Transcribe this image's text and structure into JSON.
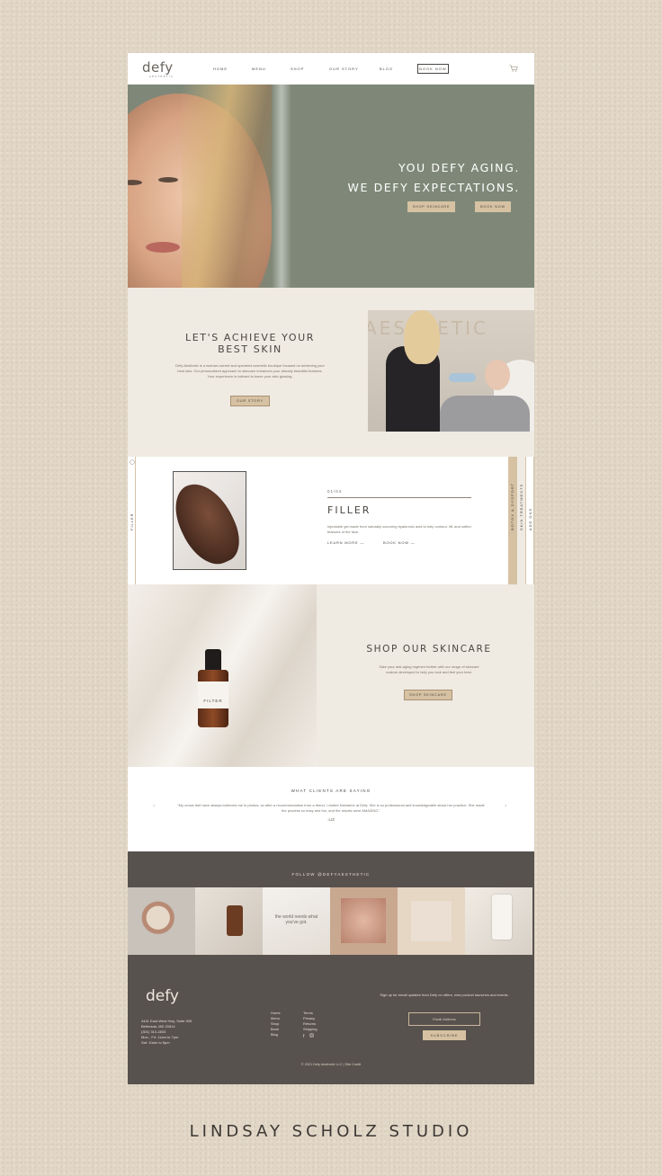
{
  "nav": {
    "logo": "defy",
    "logo_sub": "AESTHETIC",
    "items": [
      "HOME",
      "MENU",
      "SHOP",
      "OUR STORY",
      "BLOG"
    ],
    "book_label": "BOOK NOW",
    "cart_icon": "cart-icon"
  },
  "hero": {
    "line1": "YOU DEFY AGING.",
    "line2": "WE DEFY EXPECTATIONS.",
    "shop_label": "SHOP SKINCARE",
    "book_label": "BOOK NOW"
  },
  "achieve": {
    "title": "LET'S ACHIEVE YOUR BEST SKIN",
    "body": "Defy Aesthetic is a woman-owned and operated cosmetic boutique focused on achieving your best skin. Our personalized approach to skincare enhances your already beautiful features. Your experience is tailored to leave your skin glowing.",
    "button": "OUR STORY",
    "watermark": "AESTHETIC"
  },
  "services": {
    "left_tab": "FILLER",
    "number": "01/04",
    "title": "FILLER",
    "description": "Injectable gel made from naturally occurring hyaluronic acid to help contour, lift, and soften features of the face.",
    "learn_more": "LEARN MORE —",
    "book_now": "BOOK NOW —",
    "right_tabs": [
      "BOTOX & DYSPORT",
      "SKIN TREATMENTS",
      "ADD ONS"
    ]
  },
  "skincare": {
    "title": "SHOP OUR SKINCARE",
    "body": "Take your anti-aging regimen further with our range of skincare custom developed to help you look and feel your best.",
    "button": "SHOP SKINCARE",
    "bottle_label": "FILTER"
  },
  "testimonial": {
    "heading": "WHAT CLIENTS ARE SAYING",
    "quote": "\"My crows feet have always bothered me in photos, so after a recommendation from a friend, I visited Katharine at Defy. She is so professional and knowledgeable about her practice. She made the process so easy and fun, and the results were AMAZING.\"",
    "author": "-LIZ",
    "prev_icon": "chevron-left-icon",
    "next_icon": "chevron-right-icon"
  },
  "instagram": {
    "heading": "FOLLOW @DEFYAESTHETIC",
    "tile3_text": "the world needs what you've got."
  },
  "footer": {
    "logo": "defy",
    "address": [
      "4441 East-West Hwy, Suite 305",
      "Bethesda, MD 20814",
      "(301) 310-2833",
      "Mon - Fri: 11am to 7pm",
      "Sat: 10am to 5pm"
    ],
    "links_a": [
      "Home",
      "Menu",
      "Shop",
      "Book",
      "Blog"
    ],
    "links_b": [
      "Terms",
      "Privacy",
      "Returns",
      "Shipping"
    ],
    "signup_text": "Sign up for email updates from Defy on offers, new product launches and events.",
    "email_placeholder": "Email Address",
    "subscribe": "SUBSCRIBE",
    "copyright": "© 2021 Defy Aesthetic LLC  |  Site Credit"
  },
  "studio_credit": "LINDSAY SCHOLZ STUDIO",
  "colors": {
    "accent": "#d6c2a3",
    "dark": "#58524e",
    "sage": "#7f8878",
    "cream": "#efeae2"
  }
}
